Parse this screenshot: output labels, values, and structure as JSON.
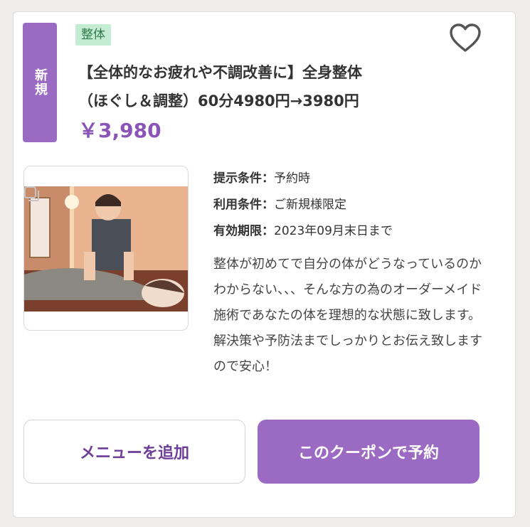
{
  "coupon": {
    "new_badge": "新規",
    "category": "整体",
    "title_line1": "【全体的なお疲れや不調改善に】全身整体",
    "title_line2": "（ほぐし＆調整）60分4980円→3980円",
    "price": "￥3,980",
    "conditions": [
      {
        "label": "提示条件：",
        "value": "予約時"
      },
      {
        "label": "利用条件：",
        "value": "ご新規様限定"
      },
      {
        "label": "有効期限：",
        "value": "2023年09月末日まで"
      }
    ],
    "description": "整体が初めてで自分の体がどうなっているのかわからない、、、そんな方の為のオーダーメイド施術であなたの体を理想的な状態に致します。解決策や予防法までしっかりとお伝え致しますので安心！",
    "favorite_icon": "heart-outline-icon"
  },
  "actions": {
    "add_menu_label": "メニューを追加",
    "reserve_label": "このクーポンで予約"
  },
  "colors": {
    "accent": "#9b6ac2",
    "price": "#8a55b6",
    "tag_bg": "#c3ecd3"
  }
}
